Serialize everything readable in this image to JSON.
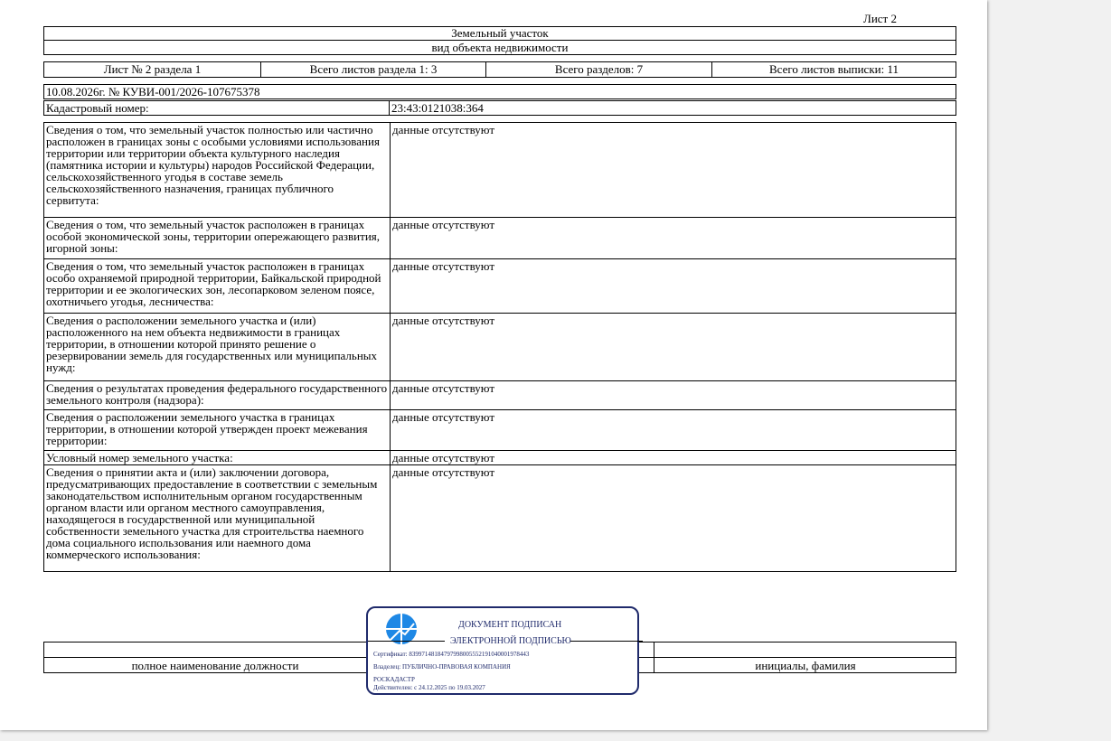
{
  "header": {
    "sheet_label": "Лист 2",
    "object_name": "Земельный участок",
    "object_type": "вид объекта недвижимости"
  },
  "summary": {
    "sheet_of_section": "Лист № 2 раздела 1",
    "total_sheets_section": "Всего листов раздела 1: 3",
    "total_sections": "Всего разделов: 7",
    "total_sheets_extract": "Всего листов выписки: 11"
  },
  "doc": {
    "date_number": "10.08.2026г. № КУВИ-001/2026-107675378",
    "cadastral_label": "Кадастровый номер:",
    "cadastral_value": "23:43:0121038:364"
  },
  "rows": [
    {
      "label": "Сведения о том, что земельный участок полностью или частично расположен в границах зоны с особыми условиями использования территории или территории объекта культурного наследия (памятника истории и культуры) народов Российской Федерации, сельскохозяйственного угодья в составе земель сельскохозяйственного назначения, границах публичного сервитута:",
      "value": "данные отсутствуют"
    },
    {
      "label": "Сведения о том, что земельный участок расположен в границах особой экономической зоны, территории опережающего развития, игорной зоны:",
      "value": "данные отсутствуют"
    },
    {
      "label": "Сведения о том, что земельный участок расположен в границах особо охраняемой природной территории, Байкальской природной территории и ее экологических зон, лесопарковом зеленом поясе, охотничьего угодья, лесничества:",
      "value": "данные отсутствуют"
    },
    {
      "label": "Сведения о расположении земельного участка и (или) расположенного на нем объекта недвижимости в границах территории, в отношении которой принято решение о резервировании земель для государственных или муниципальных нужд:",
      "value": "данные отсутствуют"
    },
    {
      "label": "Сведения о результатах проведения федерального государственного земельного контроля (надзора):",
      "value": "данные отсутствуют"
    },
    {
      "label": "Сведения о расположении земельного участка в границах территории, в отношении которой утвержден проект межевания территории:",
      "value": "данные отсутствуют"
    },
    {
      "label": "Условный номер земельного участка:",
      "value": "данные отсутствуют"
    },
    {
      "label": "Сведения о принятии акта и (или) заключении договора, предусматривающих предоставление в соответствии с земельным законодательством исполнительным органом государственным органом власти или органом местного самоуправления, находящегося в государственной или муниципальной собственности земельного участка для строительства наемного дома социального использования или наемного дома коммерческого использования:",
      "value": "данные отсутствуют"
    }
  ],
  "footer": {
    "position_caption": "полное наименование должности",
    "name_caption": "инициалы, фамилия"
  },
  "stamp": {
    "line1": "ДОКУМЕНТ ПОДПИСАН",
    "line2": "ЭЛЕКТРОННОЙ ПОДПИСЬЮ",
    "certificate": "Сертификат: 83997148184797998005552191040001978443",
    "owner": "Владелец: ПУБЛИЧНО-ПРАВОВАЯ КОМПАНИЯ",
    "owner2": "РОСКАДАСТР",
    "validity": "Действителен: с 24.12.2025 по 19.03.2027",
    "colors": {
      "ink": "#1f2a6b",
      "logo": "#1e88e5"
    }
  }
}
